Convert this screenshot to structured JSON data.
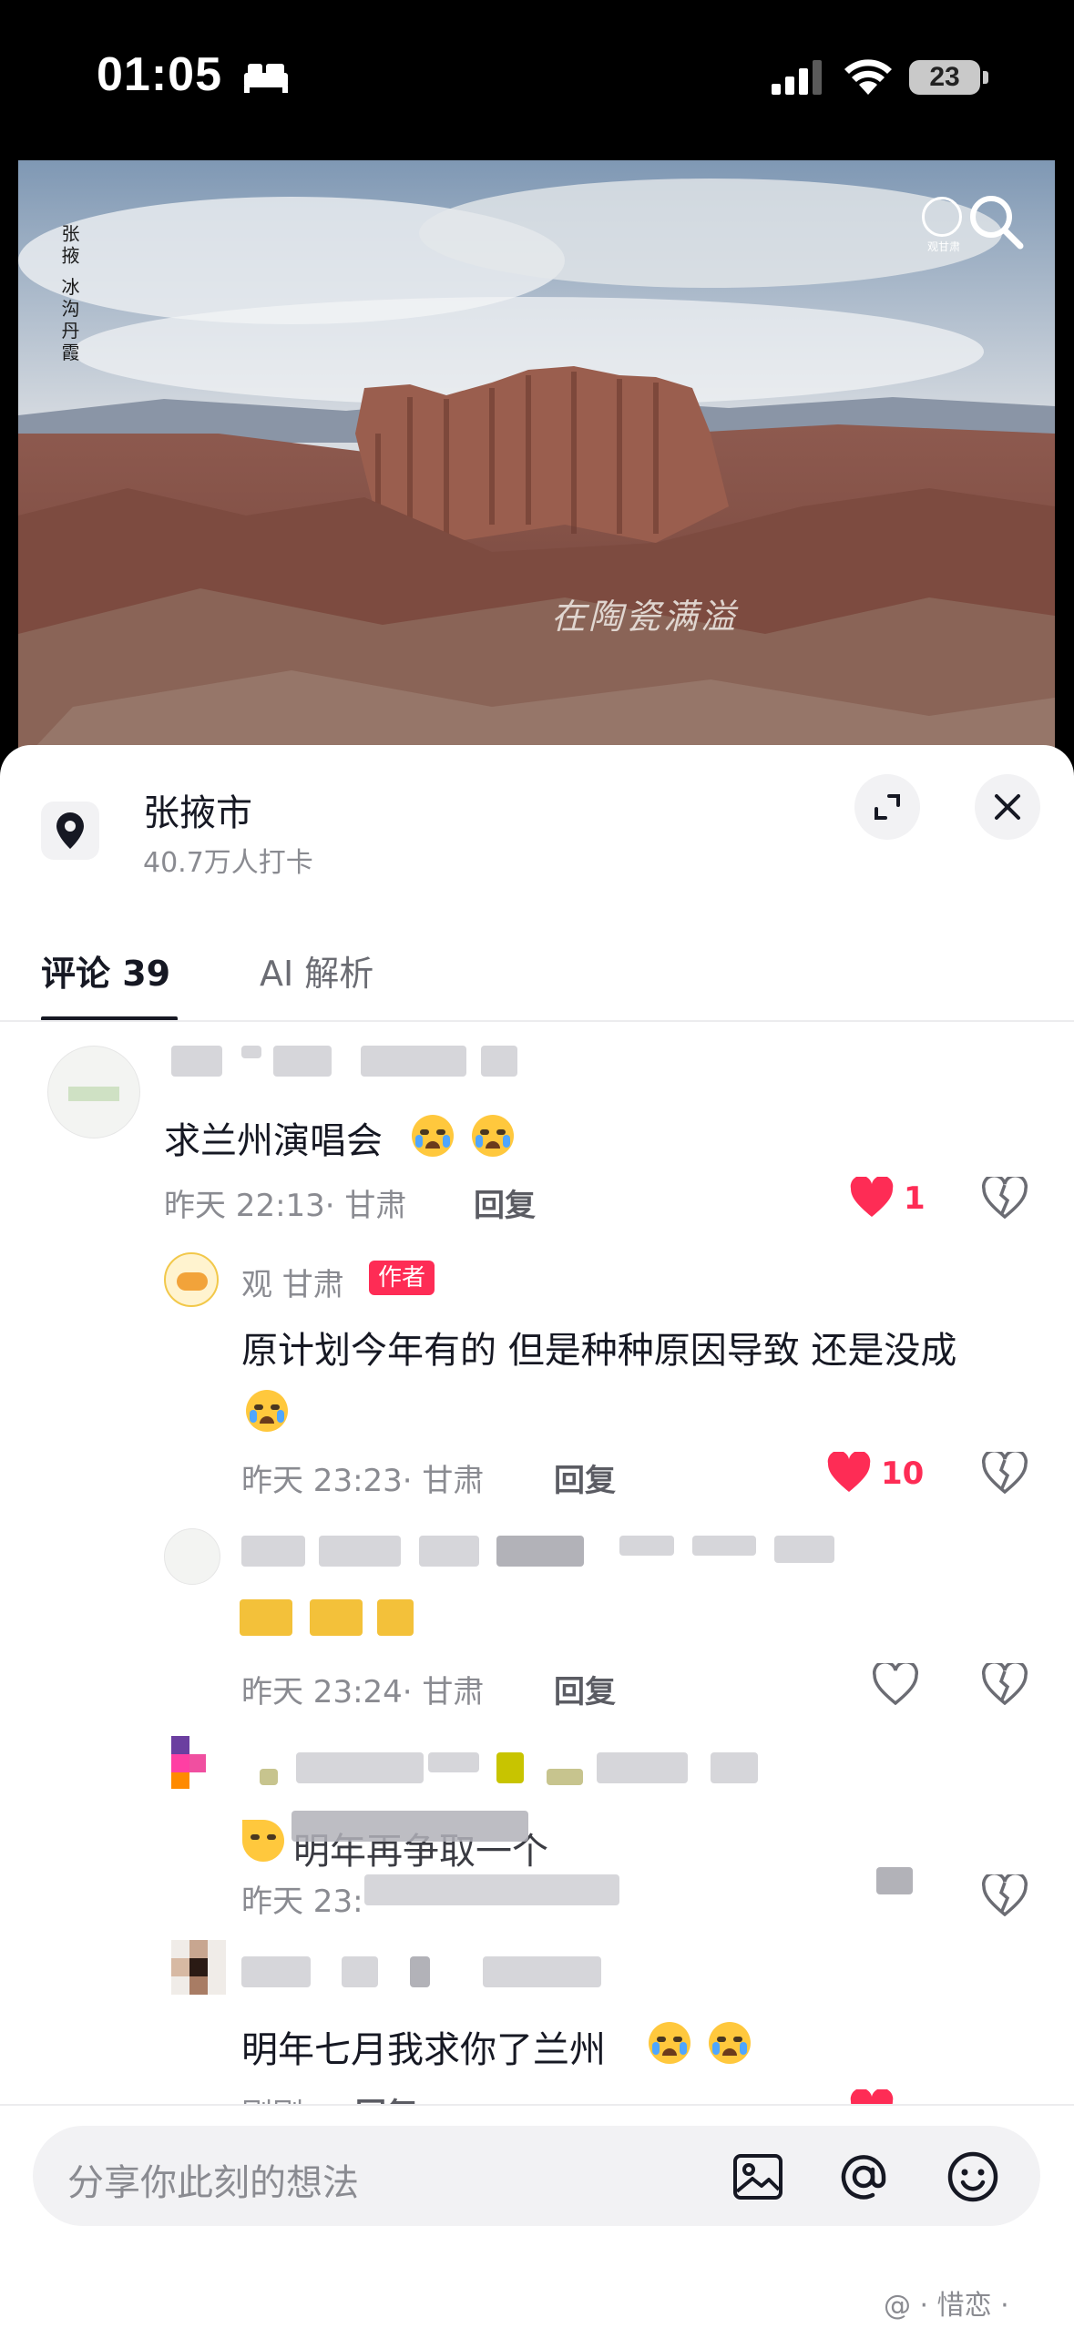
{
  "status_bar": {
    "time": "01:05",
    "battery": "23"
  },
  "video": {
    "vertical_caption": "张掖 冰沟丹霞",
    "overlay_text": "在陶瓷满溢",
    "logo_text": "观甘肃"
  },
  "location": {
    "name": "张掖市",
    "checkins": "40.7万人打卡"
  },
  "tabs": [
    {
      "label": "评论 39"
    },
    {
      "label": "AI 解析"
    }
  ],
  "comments": [
    {
      "text": "求兰州演唱会",
      "time": "昨天 22:13· 甘肃",
      "reply": "回复",
      "likes": "1"
    },
    {
      "name": "观 甘肃",
      "badge": "作者",
      "text": "原计划今年有的 但是种种原因导致 还是没成",
      "time": "昨天 23:23· 甘肃",
      "reply": "回复",
      "likes": "10"
    },
    {
      "time": "昨天 23:24· 甘肃",
      "reply": "回复"
    },
    {
      "text_fragment": "明年再争取一个",
      "time_fragment": "昨天 23:"
    },
    {
      "text": "明年七月我求你了兰州",
      "time": "刚刚",
      "reply": "回复"
    }
  ],
  "input": {
    "placeholder": "分享你此刻的想法"
  },
  "watermark": "@ · 惜恋 ·"
}
